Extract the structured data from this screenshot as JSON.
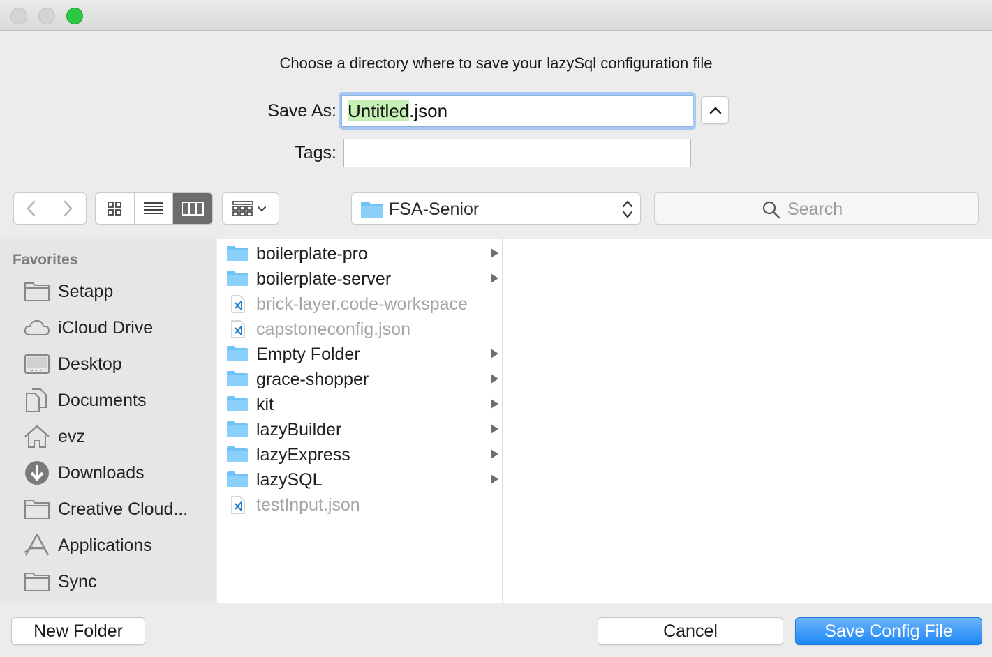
{
  "window": {
    "traffic_lights": [
      "close",
      "minimize",
      "zoom"
    ]
  },
  "dialog": {
    "message": "Choose a directory where to save your lazySql configuration file",
    "save_as_label": "Save As:",
    "save_as_selected": "Untitled",
    "save_as_rest": ".json",
    "tags_label": "Tags:",
    "tags_value": ""
  },
  "toolbar": {
    "back_icon": "chevron-left-icon",
    "forward_icon": "chevron-right-icon",
    "view_modes": [
      "icon-view",
      "list-view",
      "column-view"
    ],
    "active_view": "column-view",
    "location": "FSA-Senior",
    "search_placeholder": "Search"
  },
  "sidebar": {
    "heading": "Favorites",
    "items": [
      {
        "label": "Setapp",
        "icon": "folder-icon"
      },
      {
        "label": "iCloud Drive",
        "icon": "cloud-icon"
      },
      {
        "label": "Desktop",
        "icon": "desktop-icon"
      },
      {
        "label": "Documents",
        "icon": "documents-icon"
      },
      {
        "label": "evz",
        "icon": "home-icon"
      },
      {
        "label": "Downloads",
        "icon": "downloads-icon"
      },
      {
        "label": "Creative Cloud...",
        "icon": "folder-icon"
      },
      {
        "label": "Applications",
        "icon": "applications-icon"
      },
      {
        "label": "Sync",
        "icon": "folder-icon"
      }
    ]
  },
  "files": [
    {
      "name": "boilerplate-pro",
      "type": "folder",
      "enabled": true
    },
    {
      "name": "boilerplate-server",
      "type": "folder",
      "enabled": true
    },
    {
      "name": "brick-layer.code-workspace",
      "type": "file",
      "enabled": false
    },
    {
      "name": "capstoneconfig.json",
      "type": "file",
      "enabled": false
    },
    {
      "name": "Empty Folder",
      "type": "folder",
      "enabled": true
    },
    {
      "name": "grace-shopper",
      "type": "folder",
      "enabled": true
    },
    {
      "name": "kit",
      "type": "folder",
      "enabled": true
    },
    {
      "name": "lazyBuilder",
      "type": "folder",
      "enabled": true
    },
    {
      "name": "lazyExpress",
      "type": "folder",
      "enabled": true
    },
    {
      "name": "lazySQL",
      "type": "folder",
      "enabled": true
    },
    {
      "name": "testInput.json",
      "type": "file",
      "enabled": false
    }
  ],
  "buttons": {
    "new_folder": "New Folder",
    "cancel": "Cancel",
    "save": "Save Config File"
  },
  "colors": {
    "accent": "#1b87f6",
    "folder": "#6fc3f7",
    "selection_highlight": "#c6f0b5"
  }
}
